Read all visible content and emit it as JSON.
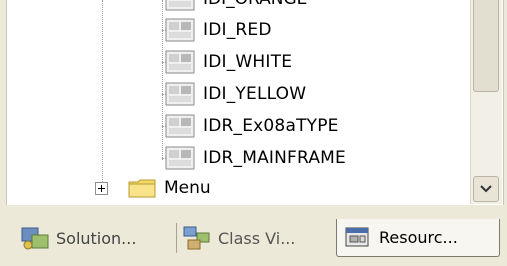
{
  "tree": {
    "partial_item": "IDI_ORANGE",
    "items": [
      {
        "label": "IDI_RED",
        "icon": "icon-resource-icon"
      },
      {
        "label": "IDI_WHITE",
        "icon": "icon-resource-icon"
      },
      {
        "label": "IDI_YELLOW",
        "icon": "icon-resource-icon"
      },
      {
        "label": "IDR_Ex08aTYPE",
        "icon": "icon-resource-icon"
      },
      {
        "label": "IDR_MAINFRAME",
        "icon": "icon-resource-icon"
      }
    ],
    "menu_node": {
      "label": "Menu",
      "expander": "+",
      "icon": "folder-icon"
    }
  },
  "tabs": [
    {
      "label": "Solution...",
      "icon": "solution-explorer-icon",
      "active": false
    },
    {
      "label": "Class Vi...",
      "icon": "class-view-icon",
      "active": false
    },
    {
      "label": "Resourc...",
      "icon": "resource-view-icon",
      "active": true
    }
  ],
  "colors": {
    "tree_bg": "#ffffff",
    "chrome_bg": "#ece9d8",
    "folder_yellow": "#f5d86a",
    "active_tab_bg": "#f7f6f0"
  }
}
